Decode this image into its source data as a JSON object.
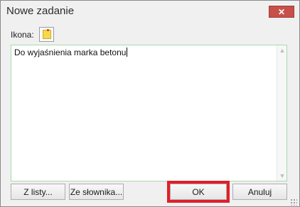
{
  "window": {
    "title": "Nowe zadanie",
    "close_glyph": "✕"
  },
  "form": {
    "icon_label": "Ikona:",
    "icon_name": "sticky-note-icon",
    "text_value": "Do wyjaśnienia marka betonu"
  },
  "buttons": {
    "from_list": "Z listy...",
    "from_dictionary": "Ze słownika...",
    "ok": "OK",
    "cancel": "Anuluj"
  },
  "colors": {
    "close_button": "#c7504a",
    "highlight": "#e01f2a",
    "editor_border": "#a9d9a9",
    "note": "#f6d84a"
  }
}
